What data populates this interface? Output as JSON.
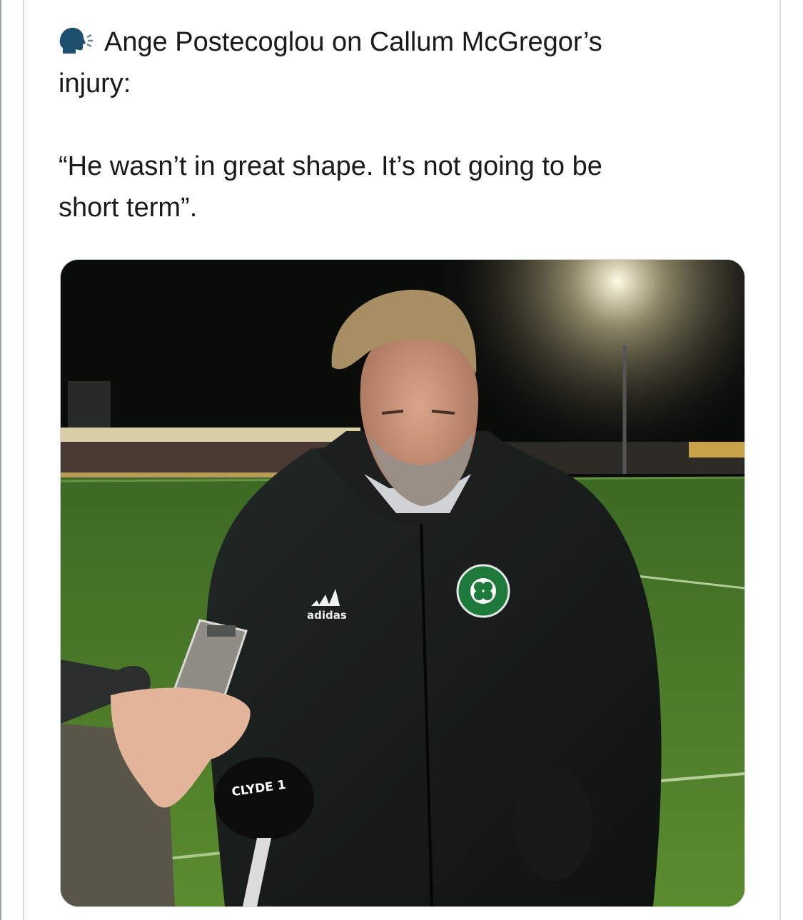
{
  "tweet": {
    "icon": "speaking-head-icon",
    "heading_line1": "Ange Postecoglou on Callum McGregor’s",
    "heading_line2": "injury:",
    "quote_line1": "“He wasn’t in great shape. It’s not going to be",
    "quote_line2": "short term”."
  },
  "media": {
    "brand_text": "adidas",
    "mic_text": "CLYDE 1"
  }
}
